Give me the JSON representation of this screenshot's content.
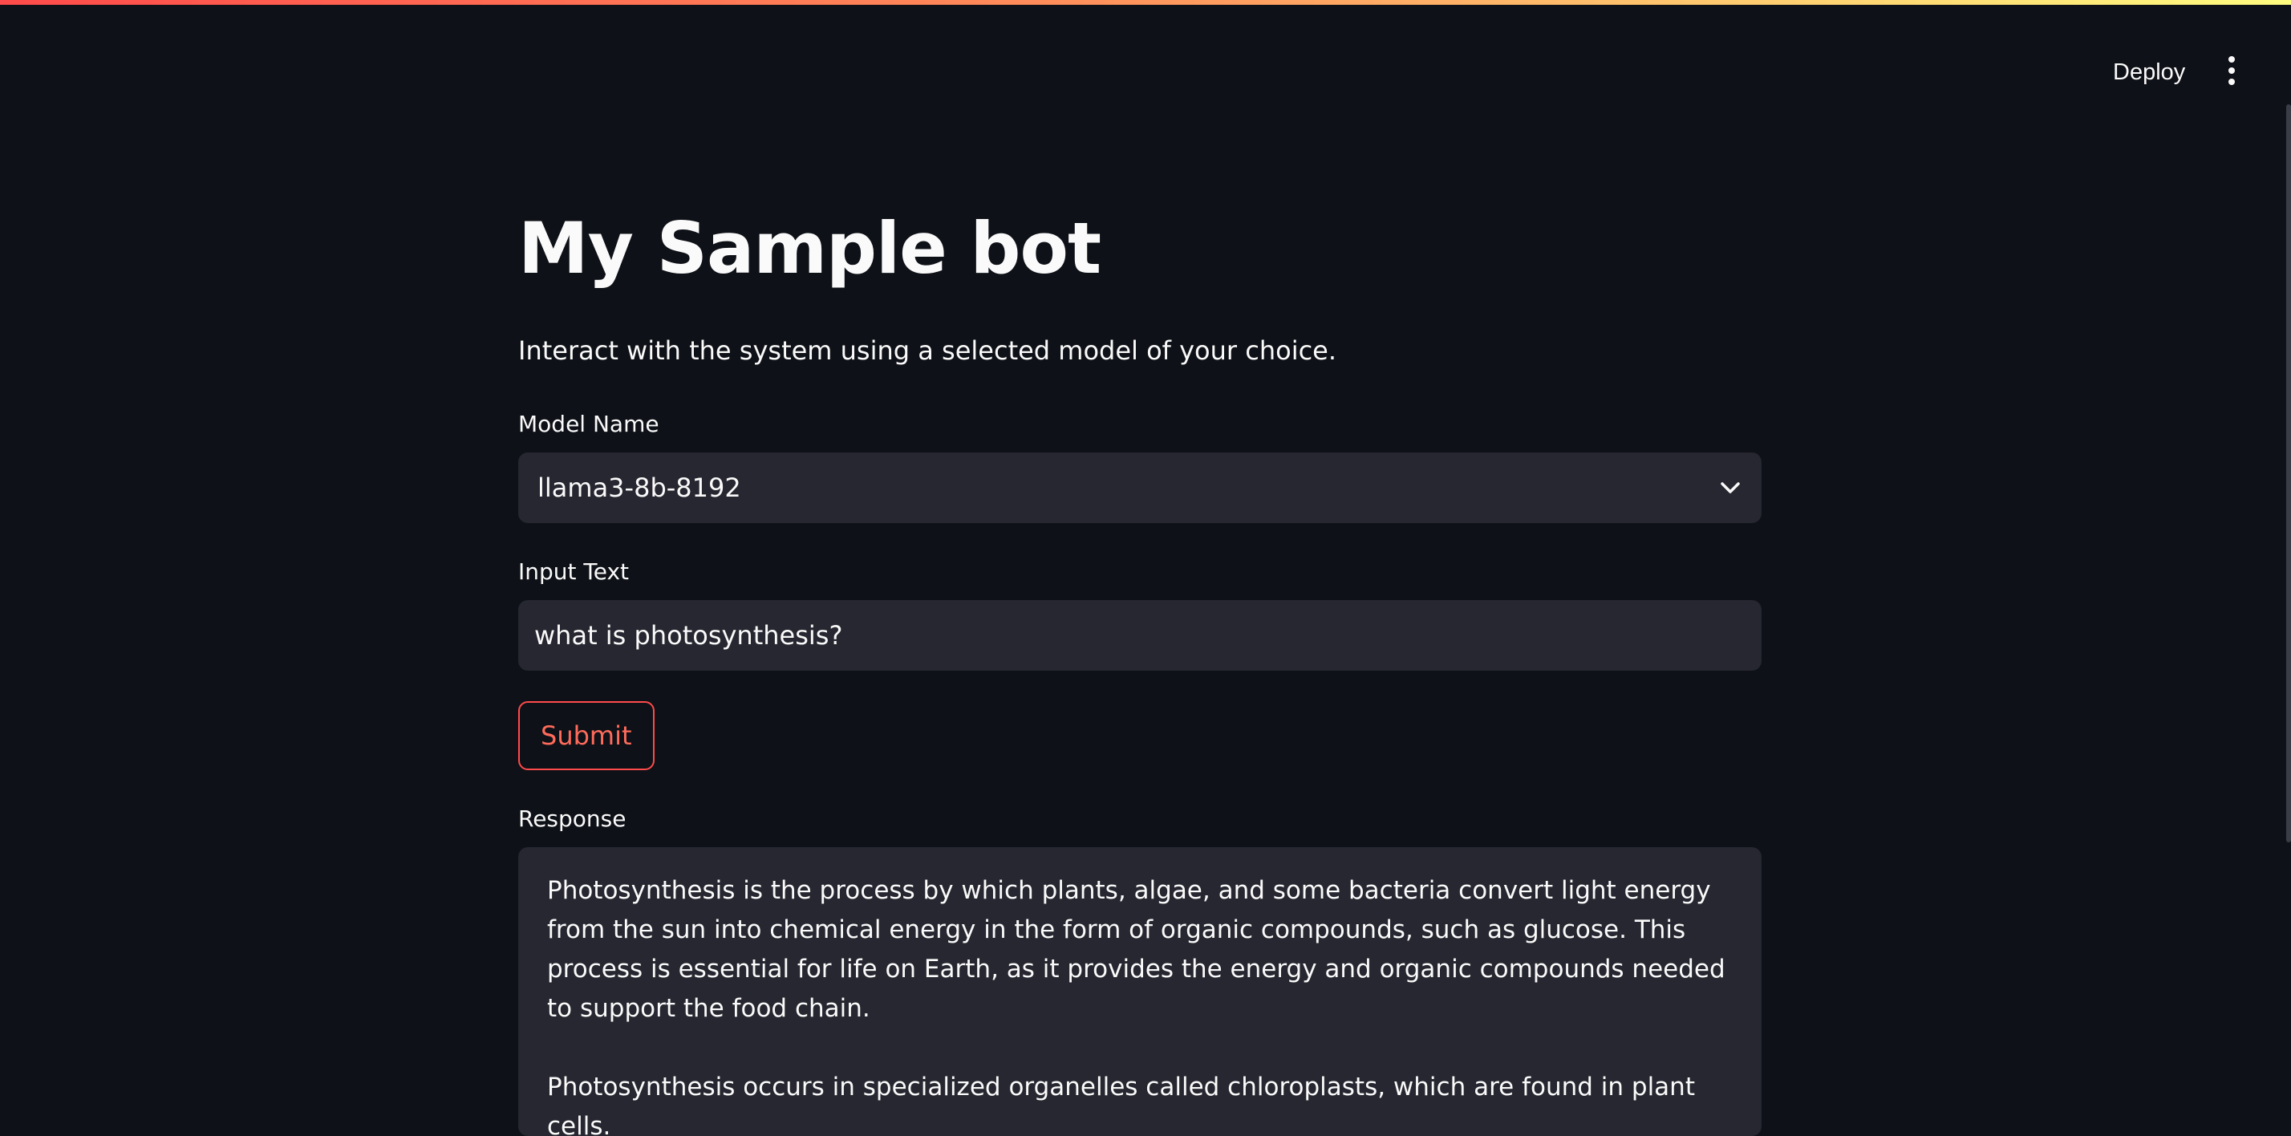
{
  "header": {
    "deploy_label": "Deploy",
    "menu_icon": "kebab-menu-icon"
  },
  "page": {
    "title": "My Sample bot",
    "subtitle": "Interact with the system using a selected model of your choice."
  },
  "model_select": {
    "label": "Model Name",
    "value": "llama3-8b-8192",
    "icon": "chevron-down-icon"
  },
  "input": {
    "label": "Input Text",
    "value": "what is photosynthesis?",
    "placeholder": ""
  },
  "submit_label": "Submit",
  "response": {
    "label": "Response",
    "paragraphs": [
      "Photosynthesis is the process by which plants, algae, and some bacteria convert light energy from the sun into chemical energy in the form of organic compounds, such as glucose. This process is essential for life on Earth, as it provides the energy and organic compounds needed to support the food chain.",
      "Photosynthesis occurs in specialized organelles called chloroplasts, which are found in plant cells."
    ]
  },
  "colors": {
    "background": "#0e1117",
    "field_background": "#262730",
    "accent": "#ff4b4b",
    "text": "#fafafa"
  }
}
